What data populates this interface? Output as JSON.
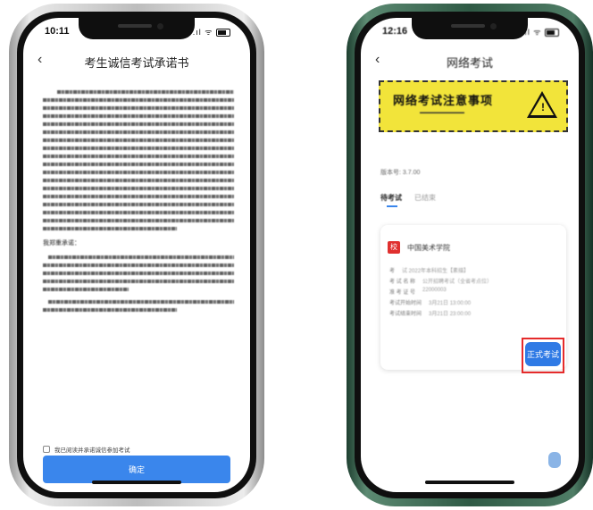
{
  "left_phone": {
    "status": {
      "time": "10:11",
      "icons": ".ıl ᯤ"
    },
    "nav": {
      "back_icon": "chevron-left-icon",
      "title": "考生诚信考试承诺书"
    },
    "pledge": {
      "salutation": "我郑重承诺：",
      "paragraphs_blurred": 3
    },
    "agree_label": "我已阅读并承诺诚信参加考试",
    "confirm_label": "确定"
  },
  "right_phone": {
    "status": {
      "time": "12:16",
      "icons": ".ıl ᯤ"
    },
    "nav": {
      "back_icon": "chevron-left-icon",
      "title": "网络考试"
    },
    "banner": {
      "title": "网络考试注意事项",
      "icon": "warning-triangle-icon"
    },
    "version_label": "版本号: 3.7.00",
    "tabs": [
      {
        "label": "待考试",
        "active": true
      },
      {
        "label": "已结束",
        "active": false
      }
    ],
    "card": {
      "school_name": "中国美术学院",
      "info_rows": [
        {
          "label": "考",
          "value": "试 2022年本科招生【素描】"
        },
        {
          "label": "考 试 名 称",
          "value": "公开招聘考试（全省考点位）"
        },
        {
          "label": "准 考 证 号",
          "value": "22000003"
        },
        {
          "label": "考试开始时间",
          "value": "3月21日 13:00:00"
        },
        {
          "label": "考试结束时间",
          "value": "3月21日 23:00:00"
        }
      ],
      "start_label": "正式考试"
    }
  },
  "colors": {
    "primary": "#3a86ec",
    "highlight": "#e52b2b",
    "banner": "#f2e43a"
  }
}
